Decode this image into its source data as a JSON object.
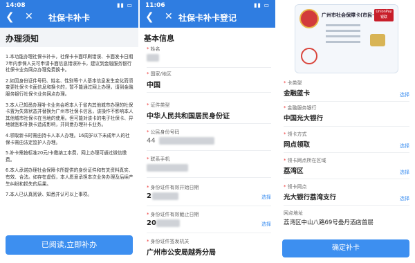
{
  "screen1": {
    "time": "14:08",
    "title": "社保卡补卡",
    "notice_heading": "办理须知",
    "notice_items": [
      "1.本功能办理社保卡补卡，社保卡卡面印刷错误、卡面发卡日期7年内参保人员可申请卡面信息错误补卡，建议到金融服务银行社保卡业务网点办理免费换卡。",
      "2.如因身份证件号码、姓名、性别等个人基本信息发生变化而须变更社保卡卡面信息和换卡的，暂不能通过网上办理，请到金融服务银行社保卡业务网点办理。",
      "3.本人已知悉办理补卡业务会将本人于省内其他城市办理的社保卡置为失效状态并替换为广州市社保卡信息，该操作不影响本人其他城市社保卡在当地的使用。但可能对该卡的电子社保卡、异地就医和补换卡造成影响，并同意办理补卡业务。",
      "4.领取新卡时需由持卡人本人办理。16周岁以下未成年人的社保卡需由法定监护人办理。",
      "5.补卡需按标准20元/卡缴纳工本费，网上办理可通过微信缴费。",
      "6.本人承诺办理社会保障卡所提供的身份证件和有关资料真实、有效、合法。如存在虚假，本人愿意承担本次业务办理及后续产生纠纷和损失的后果。",
      "7.本人已认真阅读、知悉并认可以上事项。"
    ],
    "read_button": "已阅读,立即补办"
  },
  "screen2": {
    "time": "11:06",
    "title": "社保卡补卡登记",
    "section": "基本信息",
    "fields": [
      {
        "label": "姓名",
        "value": ""
      },
      {
        "label": "国家/地区",
        "value": "中国"
      },
      {
        "label": "证件类型",
        "value": "中华人民共和国居民身份证"
      },
      {
        "label": "公民身份号码",
        "value": "44"
      },
      {
        "label": "联系手机",
        "value": ""
      },
      {
        "label": "身份证件有效开始日期",
        "value": "2",
        "pick": "选择"
      },
      {
        "label": "身份证件有效截止日期",
        "value": "20",
        "pick": "选择"
      },
      {
        "label": "身份证件签发机关",
        "value": "广州市公安局越秀分局"
      }
    ]
  },
  "screen3": {
    "card_title": "广州市社会保障卡(市民卡)",
    "card_logo": "UnionPay 银联",
    "fields": [
      {
        "label": "卡类型",
        "value": "金融蓝卡",
        "pick": "选择"
      },
      {
        "label": "金融服务银行",
        "value": "中国光大银行"
      },
      {
        "label": "领卡方式",
        "value": "网点领取",
        "pick": "选择"
      },
      {
        "label": "领卡网点所在区域",
        "value": "荔湾区",
        "pick": "选择"
      },
      {
        "label": "领卡网点",
        "value": "光大银行荔湾支行",
        "pick": "选择"
      },
      {
        "label": "网点地址",
        "value": "荔湾区中山八路69号叠丹酒店首层"
      }
    ],
    "confirm_button": "确定补卡"
  }
}
